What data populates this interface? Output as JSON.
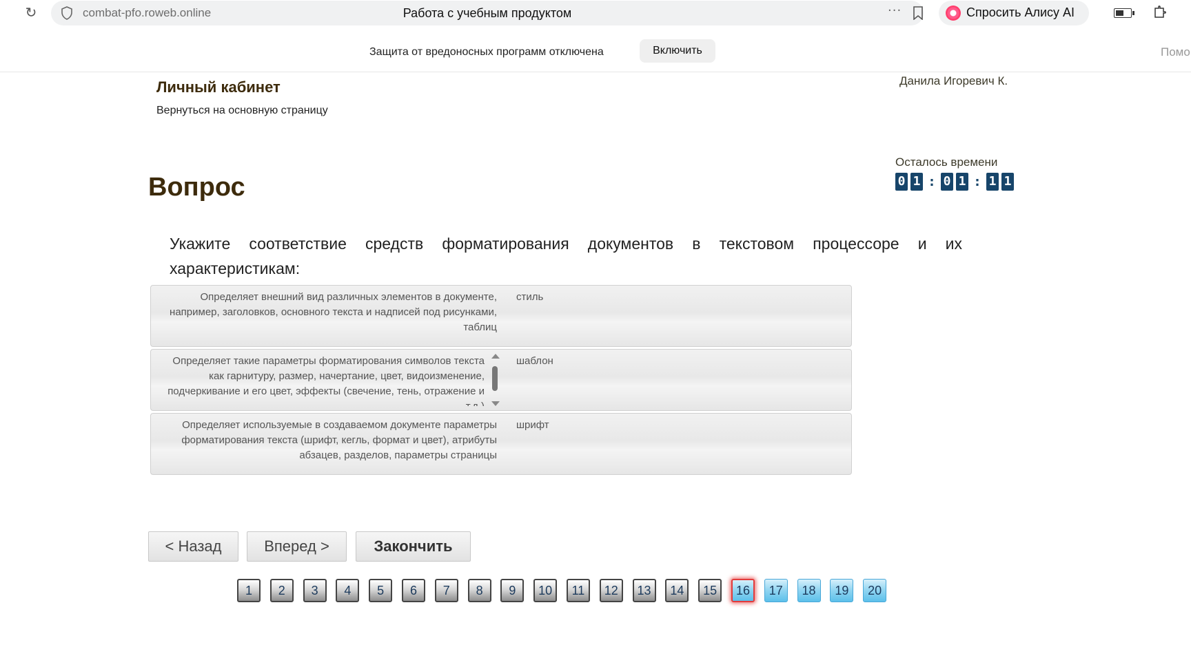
{
  "browser": {
    "url": "combat-pfo.roweb.online",
    "title": "Работа с учебным продуктом",
    "more_label": "···",
    "alice_label": "Спросить Алису AI"
  },
  "warning": {
    "text": "Защита от вредоносных программ отключена",
    "enable_label": "Включить",
    "help_text": "Помо"
  },
  "header": {
    "title": "Личный кабинет",
    "back_link": "Вернуться на основную страницу",
    "user": "Данила Игоревич К."
  },
  "timer": {
    "label": "Осталось времени",
    "digits": [
      "0",
      "1",
      "0",
      "1",
      "1",
      "1"
    ]
  },
  "question": {
    "heading": "Вопрос",
    "text": "Укажите соответствие средств форматирования документов в текстовом процессоре и их характеристикам:",
    "pairs": [
      {
        "definition": "Определяет внешний вид различных элементов в документе, например, заголовков, основного текста и надписей под рисунками, таблиц",
        "term": "стиль"
      },
      {
        "definition": "Определяет такие параметры форматирования символов текста как гарнитуру, размер, начертание, цвет, видоизменение, подчеркивание и его цвет, эффекты (свечение, тень, отражение и т.д.)",
        "term": "шаблон"
      },
      {
        "definition": "Определяет используемые в создаваемом документе параметры форматирования текста (шрифт, кегль, формат и цвет), атрибуты абзацев, разделов, параметры страницы",
        "term": "шрифт"
      }
    ]
  },
  "nav": {
    "back_label": "< Назад",
    "forward_label": "Вперед >",
    "finish_label": "Закончить"
  },
  "pagination": {
    "pages": [
      "1",
      "2",
      "3",
      "4",
      "5",
      "6",
      "7",
      "8",
      "9",
      "10",
      "11",
      "12",
      "13",
      "14",
      "15",
      "16",
      "17",
      "18",
      "19",
      "20"
    ],
    "current": "16"
  }
}
